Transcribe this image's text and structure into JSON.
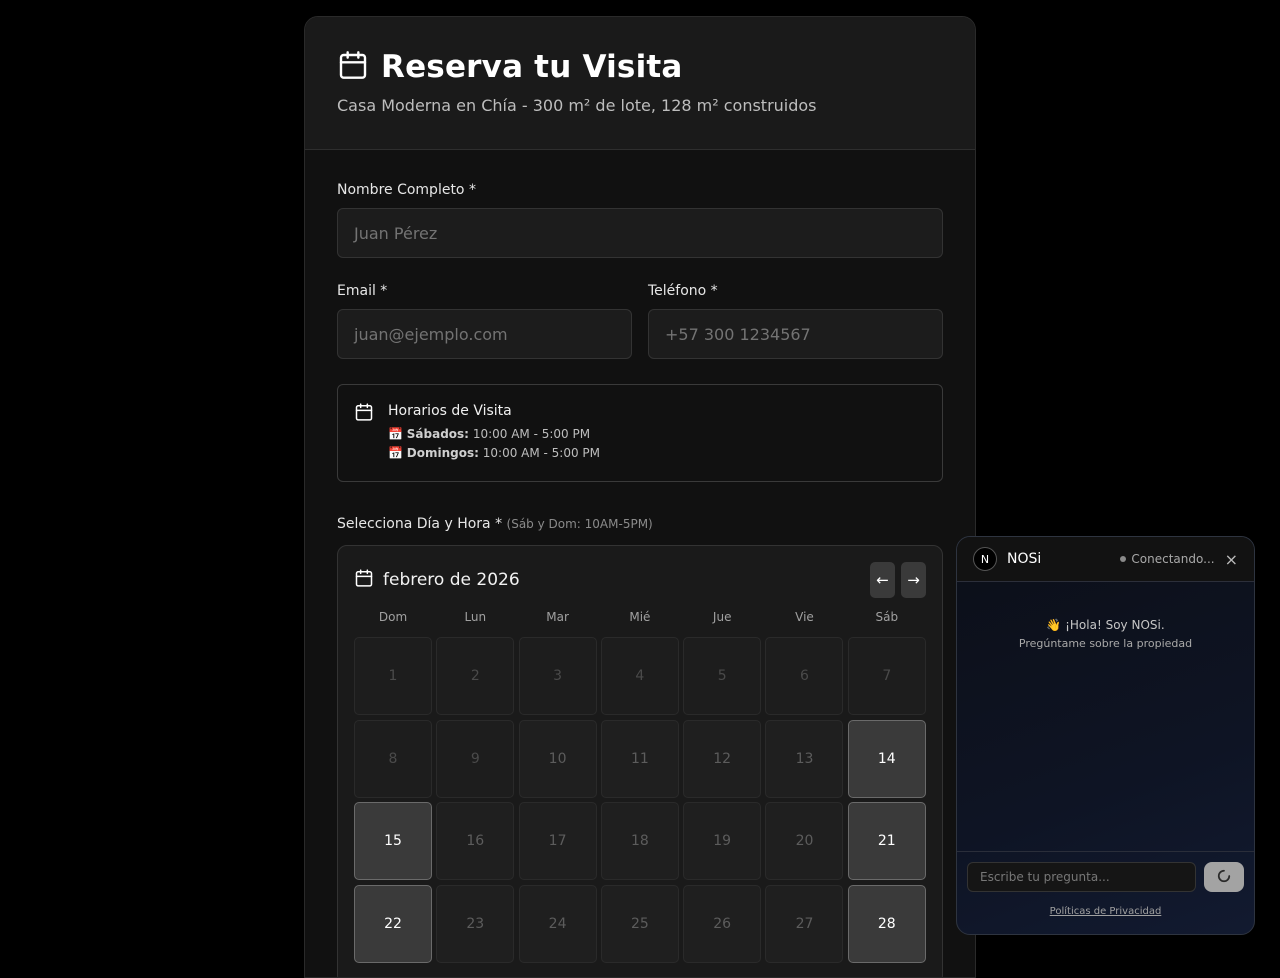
{
  "header": {
    "title": "Reserva tu Visita",
    "subtitle": "Casa Moderna en Chía - 300 m² de lote, 128 m² construidos",
    "icon": "calendar-icon"
  },
  "form": {
    "name": {
      "label": "Nombre Completo *",
      "placeholder": "Juan Pérez",
      "value": ""
    },
    "email": {
      "label": "Email *",
      "placeholder": "juan@ejemplo.com",
      "value": ""
    },
    "phone": {
      "label": "Teléfono *",
      "placeholder": "+57 300 1234567",
      "value": ""
    }
  },
  "schedule": {
    "title": "Horarios de Visita",
    "saturday_label": "Sábados:",
    "saturday_hours": "10:00 AM - 5:00 PM",
    "sunday_label": "Domingos:",
    "sunday_hours": "10:00 AM - 5:00 PM",
    "emoji": "📅"
  },
  "select": {
    "label": "Selecciona Día y Hora *",
    "hint": "(Sáb y Dom: 10AM-5PM)"
  },
  "calendar": {
    "month": "febrero de 2026",
    "prev": "←",
    "next": "→",
    "weekdays": [
      "Dom",
      "Lun",
      "Mar",
      "Mié",
      "Jue",
      "Vie",
      "Sáb"
    ],
    "days": [
      {
        "n": "1",
        "state": "past"
      },
      {
        "n": "2",
        "state": "past"
      },
      {
        "n": "3",
        "state": "past"
      },
      {
        "n": "4",
        "state": "past"
      },
      {
        "n": "5",
        "state": "past"
      },
      {
        "n": "6",
        "state": "past"
      },
      {
        "n": "7",
        "state": "past"
      },
      {
        "n": "8",
        "state": "past"
      },
      {
        "n": "9",
        "state": "past"
      },
      {
        "n": "10",
        "state": "off"
      },
      {
        "n": "11",
        "state": "off"
      },
      {
        "n": "12",
        "state": "off"
      },
      {
        "n": "13",
        "state": "off"
      },
      {
        "n": "14",
        "state": "avail"
      },
      {
        "n": "15",
        "state": "avail"
      },
      {
        "n": "16",
        "state": "off"
      },
      {
        "n": "17",
        "state": "off"
      },
      {
        "n": "18",
        "state": "off"
      },
      {
        "n": "19",
        "state": "off"
      },
      {
        "n": "20",
        "state": "off"
      },
      {
        "n": "21",
        "state": "avail"
      },
      {
        "n": "22",
        "state": "avail"
      },
      {
        "n": "23",
        "state": "off"
      },
      {
        "n": "24",
        "state": "off"
      },
      {
        "n": "25",
        "state": "off"
      },
      {
        "n": "26",
        "state": "off"
      },
      {
        "n": "27",
        "state": "off"
      },
      {
        "n": "28",
        "state": "avail"
      }
    ]
  },
  "chat": {
    "logo": "N",
    "name": "NOSi",
    "status": "Conectando...",
    "close": "×",
    "greeting": "👋 ¡Hola! Soy NOSi.",
    "greeting_sub": "Pregúntame sobre la propiedad",
    "input_placeholder": "Escribe tu pregunta...",
    "privacy": "Políticas de Privacidad"
  }
}
